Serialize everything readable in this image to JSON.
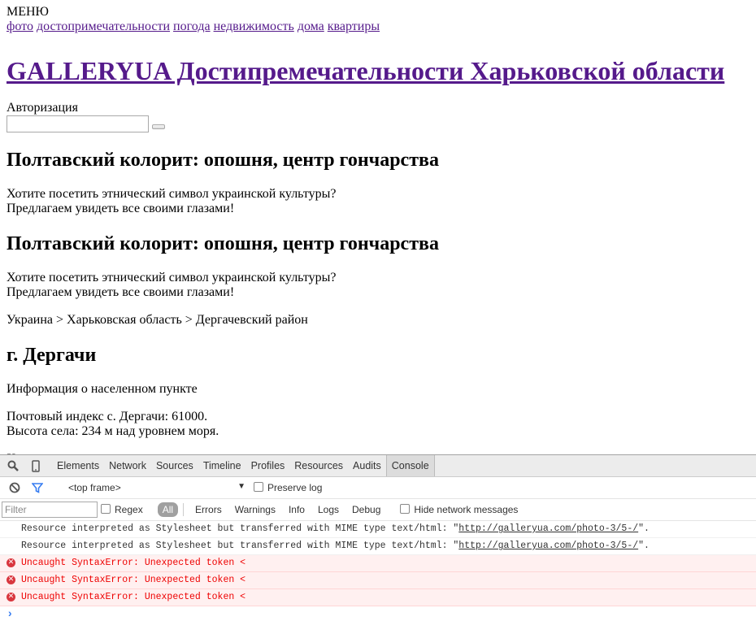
{
  "menu": {
    "title": "МЕНЮ",
    "links": [
      "фото",
      "достопримечательности",
      "погода",
      "недвижимость",
      "дома",
      "квартиры"
    ]
  },
  "site_title": "GALLERYUA Достипремечательности Харьковской области",
  "auth": {
    "label": "Авторизация",
    "input_value": ""
  },
  "posts": [
    {
      "title": "Полтавский колорит: опошня, центр гончарства",
      "line1": "Хотите посетить этнический символ украинской культуры?",
      "line2": "Предлагаем увидеть все своими глазами!"
    },
    {
      "title": "Полтавский колорит: опошня, центр гончарства",
      "line1": "Хотите посетить этнический символ украинской культуры?",
      "line2": "Предлагаем увидеть все своими глазами!"
    }
  ],
  "breadcrumb": "Украина > Харьковская область > Дергачевский район",
  "city": {
    "title": "г. Дергачи",
    "info": "Информация о населенном пункте",
    "postal": "Почтовый индекс с. Дергачи: 61000.",
    "altitude": "Высота села: 234 м над уровнем моря.",
    "cut_text": "Х"
  },
  "devtools": {
    "tabs": [
      "Elements",
      "Network",
      "Sources",
      "Timeline",
      "Profiles",
      "Resources",
      "Audits",
      "Console"
    ],
    "active_tab": "Console",
    "frame": "<top frame>",
    "frame_arrow": "▼",
    "preserve_log": "Preserve log",
    "filter_placeholder": "Filter",
    "regex": "Regex",
    "levels": [
      "All",
      "Errors",
      "Warnings",
      "Info",
      "Logs",
      "Debug"
    ],
    "hide_network": "Hide network messages",
    "messages": [
      {
        "type": "warn",
        "text": "Resource interpreted as Stylesheet but transferred with MIME type text/html: \"",
        "link": "http://galleryua.com/photo-3/5-/",
        "tail": "\"."
      },
      {
        "type": "warn",
        "text": "Resource interpreted as Stylesheet but transferred with MIME type text/html: \"",
        "link": "http://galleryua.com/photo-3/5-/",
        "tail": "\"."
      },
      {
        "type": "error",
        "text": "Uncaught SyntaxError: Unexpected token <"
      },
      {
        "type": "error",
        "text": "Uncaught SyntaxError: Unexpected token <"
      },
      {
        "type": "error",
        "text": "Uncaught SyntaxError: Unexpected token <"
      }
    ],
    "prompt": "›",
    "error_glyph": "✕"
  }
}
